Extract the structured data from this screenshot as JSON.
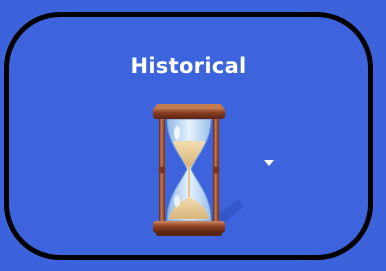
{
  "tile": {
    "title": "Historical",
    "icon": "hourglass-icon",
    "dropdown_icon": "chevron-down-icon"
  },
  "colors": {
    "background": "#3d63dc",
    "border": "#000000",
    "title": "#ffffff"
  }
}
